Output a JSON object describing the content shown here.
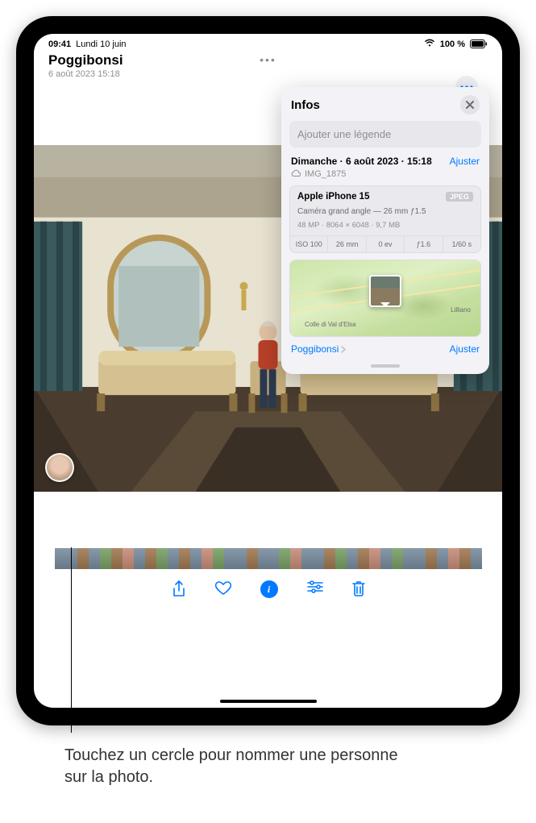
{
  "status": {
    "time": "09:41",
    "date": "Lundi 10 juin",
    "battery_text": "100 %",
    "wifi": "wifi-icon"
  },
  "header": {
    "title": "Poggibonsi",
    "subtitle": "6 août 2023  15:18"
  },
  "info": {
    "title": "Infos",
    "caption_placeholder": "Ajouter une légende",
    "date_line": "Dimanche · 6 août 2023 · 15:18",
    "adjust_label": "Ajuster",
    "filename": "IMG_1875",
    "camera": {
      "device": "Apple iPhone 15",
      "format_badge": "JPEG",
      "lens": "Caméra grand angle — 26 mm ƒ1.5",
      "specs": "48 MP · 8064 × 6048 · 9,7 MB",
      "exif": {
        "iso": "ISO 100",
        "focal": "26 mm",
        "ev": "0 ev",
        "aperture": "ƒ1.6",
        "shutter": "1/60 s"
      }
    },
    "map": {
      "location_link": "Poggibonsi",
      "adjust_label": "Ajuster",
      "place1": "Colle di Val d'Elsa",
      "place2": "Lilliano"
    }
  },
  "toolbar": {
    "share": "share-icon",
    "favorite": "heart-icon",
    "info": "info-icon",
    "edit": "sliders-icon",
    "trash": "trash-icon"
  },
  "callout": {
    "text": "Touchez un cercle pour nommer une personne sur la photo."
  }
}
